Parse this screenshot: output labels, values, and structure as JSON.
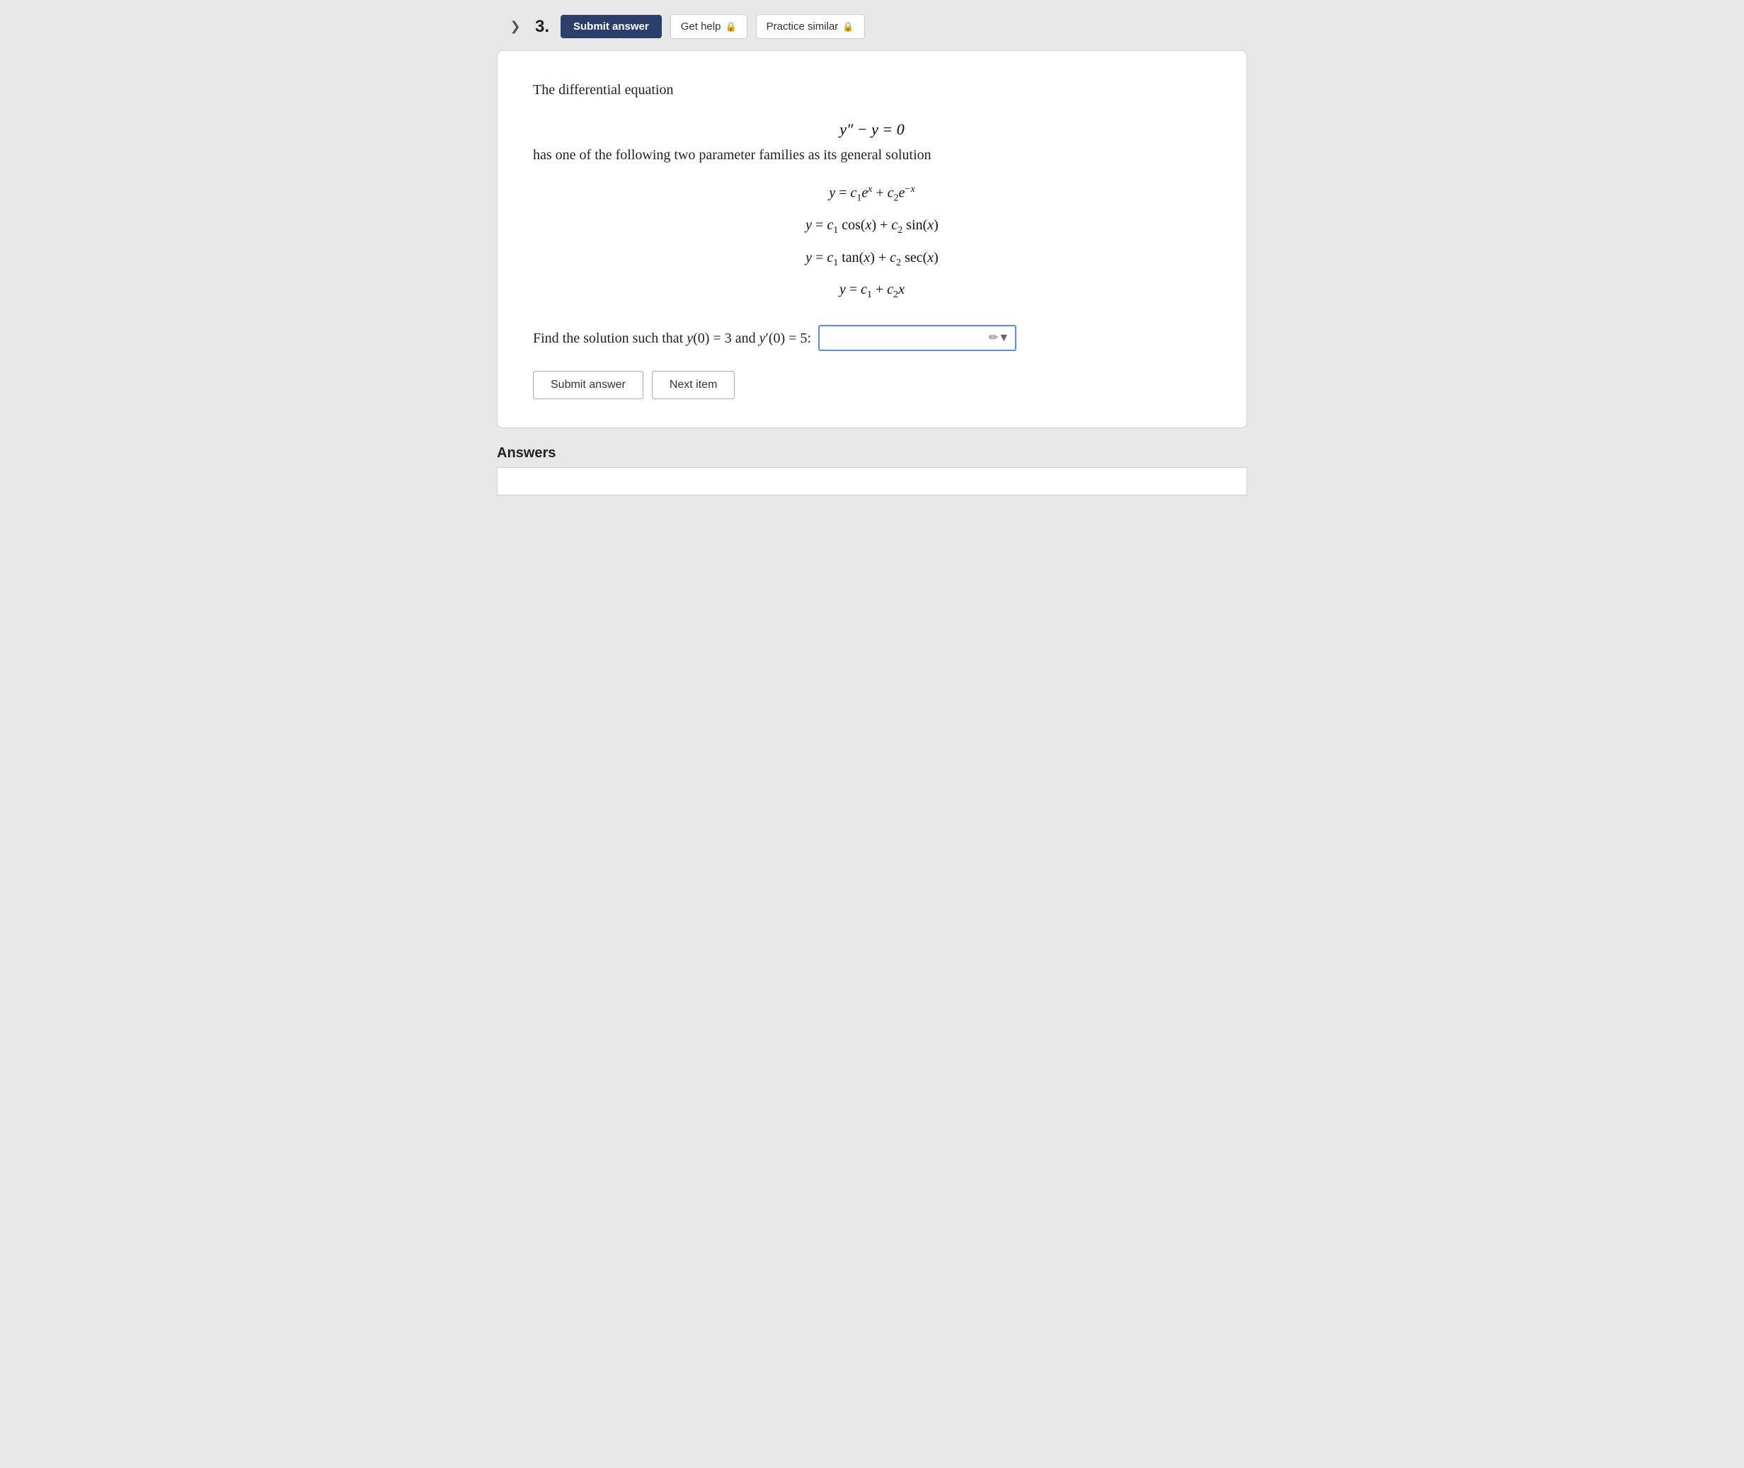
{
  "toolbar": {
    "nav_chevron": "❯",
    "question_number": "3.",
    "submit_top_label": "Submit answer",
    "get_help_label": "Get help",
    "practice_similar_label": "Practice similar",
    "lock_icon": "🔒"
  },
  "question": {
    "intro": "The differential equation",
    "main_equation": "y″ − y = 0",
    "solution_intro": "has one of the following two parameter families as its general solution",
    "options": [
      "y = c₁eˣ + c₂e⁻ˣ",
      "y = c₁ cos(x) + c₂ sin(x)",
      "y = c₁ tan(x) + c₂ sec(x)",
      "y = c₁ + c₂x"
    ],
    "find_solution_text": "Find the solution such that y(0) = 3 and y′(0) = 5:",
    "answer_placeholder": "",
    "submit_bottom_label": "Submit answer",
    "next_item_label": "Next item"
  },
  "answers_section": {
    "label": "Answers"
  }
}
